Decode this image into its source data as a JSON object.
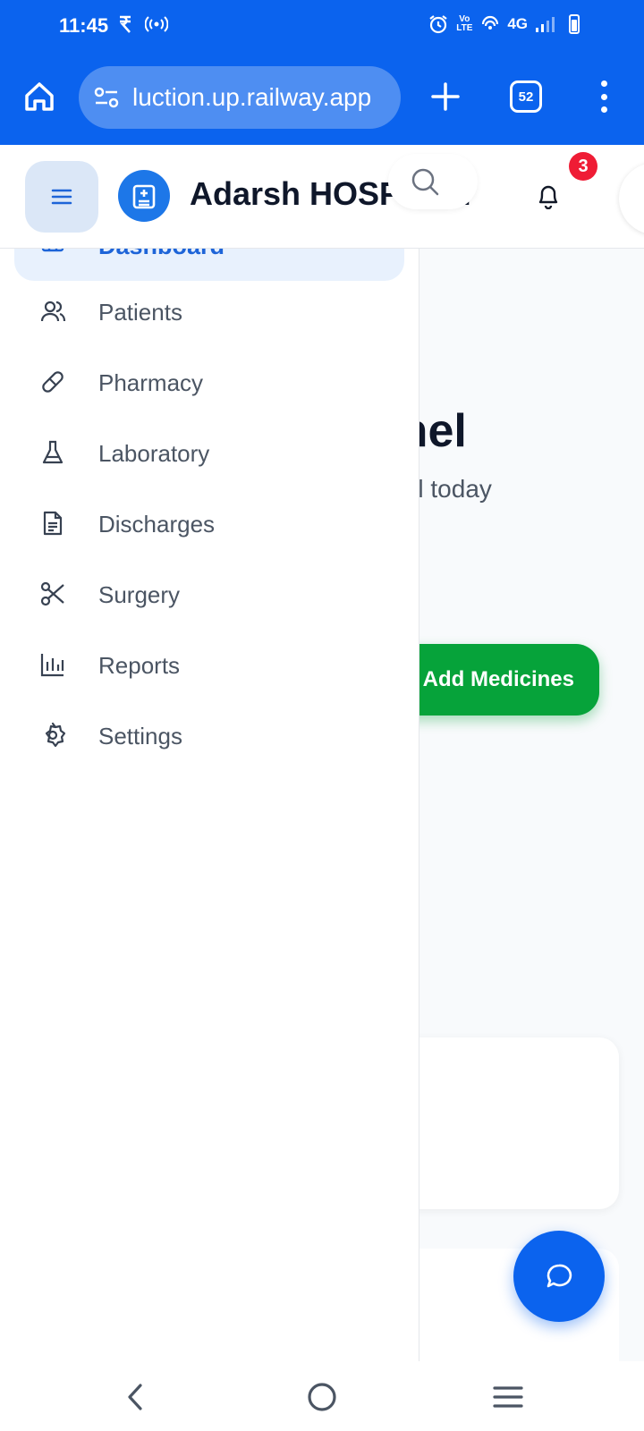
{
  "status_bar": {
    "time": "11:45",
    "network": "4G",
    "volte": "Vo LTE"
  },
  "browser": {
    "url": "luction.up.railway.app",
    "tab_count": "52"
  },
  "app_header": {
    "brand": "Adarsh HOSPITAL",
    "notification_count": "3"
  },
  "main": {
    "heading": "Michel",
    "subtitle": "r hospital today",
    "add_medicines_label": "Add Medicines"
  },
  "sidebar": {
    "active_item": {
      "label": "Dashboard",
      "icon": "dashboard-icon"
    },
    "items": [
      {
        "label": "Patients",
        "icon": "users-icon"
      },
      {
        "label": "Pharmacy",
        "icon": "pill-icon"
      },
      {
        "label": "Laboratory",
        "icon": "flask-icon"
      },
      {
        "label": "Discharges",
        "icon": "document-icon"
      },
      {
        "label": "Surgery",
        "icon": "scissors-icon"
      },
      {
        "label": "Reports",
        "icon": "bar-chart-icon"
      },
      {
        "label": "Settings",
        "icon": "gear-icon"
      }
    ]
  },
  "colors": {
    "brand_blue": "#0b63ee",
    "accent_green": "#06a33a",
    "badge_red": "#ef1c35",
    "active_nav_bg": "#e8f1fd"
  }
}
